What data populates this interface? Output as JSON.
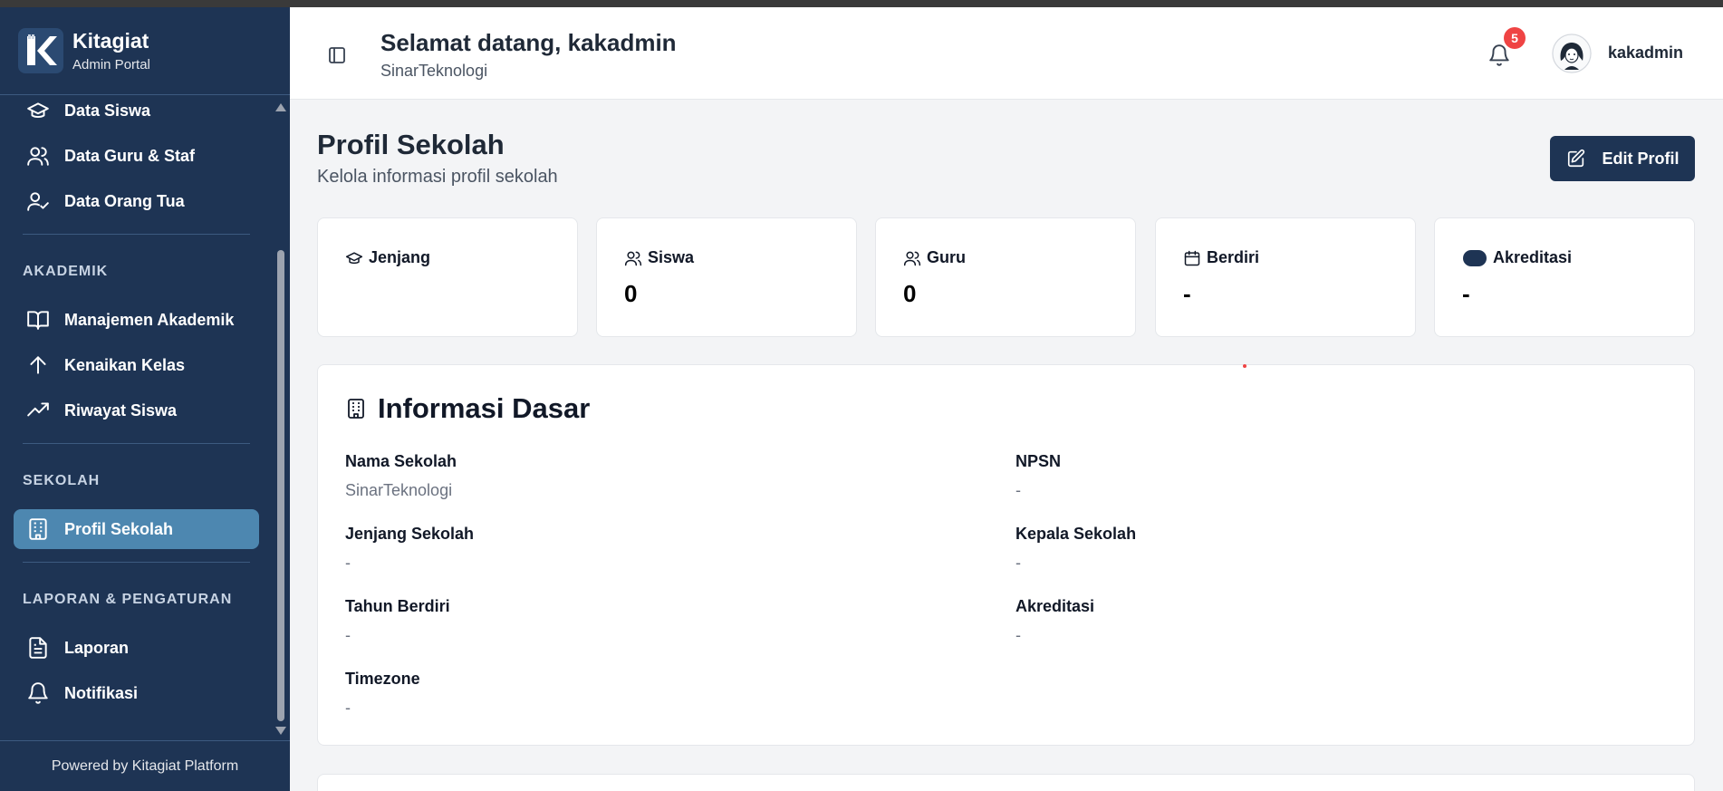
{
  "brand": {
    "name": "Kitagiat",
    "subtitle": "Admin Portal"
  },
  "sidebar": {
    "items_top": [
      {
        "label": "Data Siswa",
        "icon": "graduation-cap-icon"
      },
      {
        "label": "Data Guru & Staf",
        "icon": "users-icon"
      },
      {
        "label": "Data Orang Tua",
        "icon": "user-check-icon"
      }
    ],
    "sections": [
      {
        "title": "AKADEMIK",
        "items": [
          {
            "label": "Manajemen Akademik",
            "icon": "book-open-icon"
          },
          {
            "label": "Kenaikan Kelas",
            "icon": "arrow-up-icon"
          },
          {
            "label": "Riwayat Siswa",
            "icon": "trending-up-icon"
          }
        ]
      },
      {
        "title": "SEKOLAH",
        "items": [
          {
            "label": "Profil Sekolah",
            "icon": "building-icon",
            "active": true
          }
        ]
      },
      {
        "title": "LAPORAN & PENGATURAN",
        "items": [
          {
            "label": "Laporan",
            "icon": "file-text-icon"
          },
          {
            "label": "Notifikasi",
            "icon": "bell-icon"
          }
        ]
      }
    ],
    "footer": "Powered by Kitagiat Platform"
  },
  "header": {
    "welcome": "Selamat datang, kakadmin",
    "org": "SinarTeknologi",
    "notification_count": "5",
    "username": "kakadmin"
  },
  "page": {
    "title": "Profil Sekolah",
    "subtitle": "Kelola informasi profil sekolah",
    "edit_label": "Edit Profil"
  },
  "stats": [
    {
      "label": "Jenjang",
      "value": "",
      "icon": "graduation-cap-icon"
    },
    {
      "label": "Siswa",
      "value": "0",
      "icon": "users-icon"
    },
    {
      "label": "Guru",
      "value": "0",
      "icon": "users-icon"
    },
    {
      "label": "Berdiri",
      "value": "-",
      "icon": "calendar-icon"
    },
    {
      "label": "Akreditasi",
      "value": "-",
      "icon": "award-icon"
    }
  ],
  "info": {
    "title": "Informasi Dasar",
    "fields": [
      {
        "label": "Nama Sekolah",
        "value": "SinarTeknologi"
      },
      {
        "label": "NPSN",
        "value": "-"
      },
      {
        "label": "Jenjang Sekolah",
        "value": "-"
      },
      {
        "label": "Kepala Sekolah",
        "value": "-"
      },
      {
        "label": "Tahun Berdiri",
        "value": "-"
      },
      {
        "label": "Akreditasi",
        "value": "-"
      },
      {
        "label": "Timezone",
        "value": "-"
      }
    ]
  },
  "colors": {
    "sidebar": "#1e3454",
    "active": "#4d87b0",
    "badge": "#ef4444"
  }
}
